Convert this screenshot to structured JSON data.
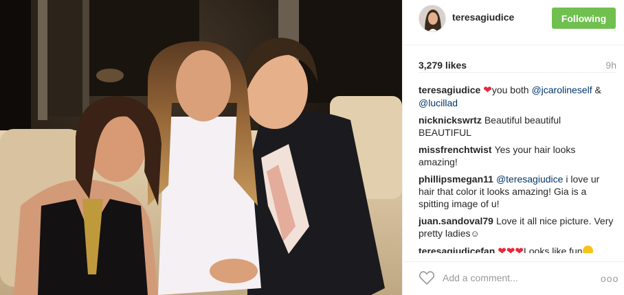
{
  "post": {
    "username": "teresagiudice",
    "follow_label": "Following",
    "likes": "3,279 likes",
    "time": "9h",
    "comment_placeholder": "Add a comment...",
    "more_label": "ooo"
  },
  "colors": {
    "follow_button": "#70c050",
    "mention": "#003569",
    "heart": "#e8283b"
  },
  "comments": [
    {
      "author": "teresagiudice",
      "heart": "❤",
      "text_a": "you both ",
      "mention_a": "@jcarolineself",
      "text_b": " & ",
      "mention_b": "@lucillad"
    },
    {
      "author": "nicknickswrtz",
      "text": "Beautiful beautiful BEAUTIFUL"
    },
    {
      "author": "missfrenchtwist",
      "text": "Yes your hair looks amazing!"
    },
    {
      "author": "phillipsmegan11",
      "mention": "@teresagiudice",
      "text": " i love ur hair that color it looks amazing! Gia is a spitting image of u!"
    },
    {
      "author": "juan.sandoval79",
      "text": "Love it all nice picture. Very pretty ladies",
      "emoji": "☺"
    },
    {
      "author": "teresagiudicefan",
      "hearts": "❤❤❤",
      "text": "Looks like fun"
    }
  ],
  "icons": {
    "heart_outline": "heart-outline-icon",
    "more": "more-options-icon"
  }
}
